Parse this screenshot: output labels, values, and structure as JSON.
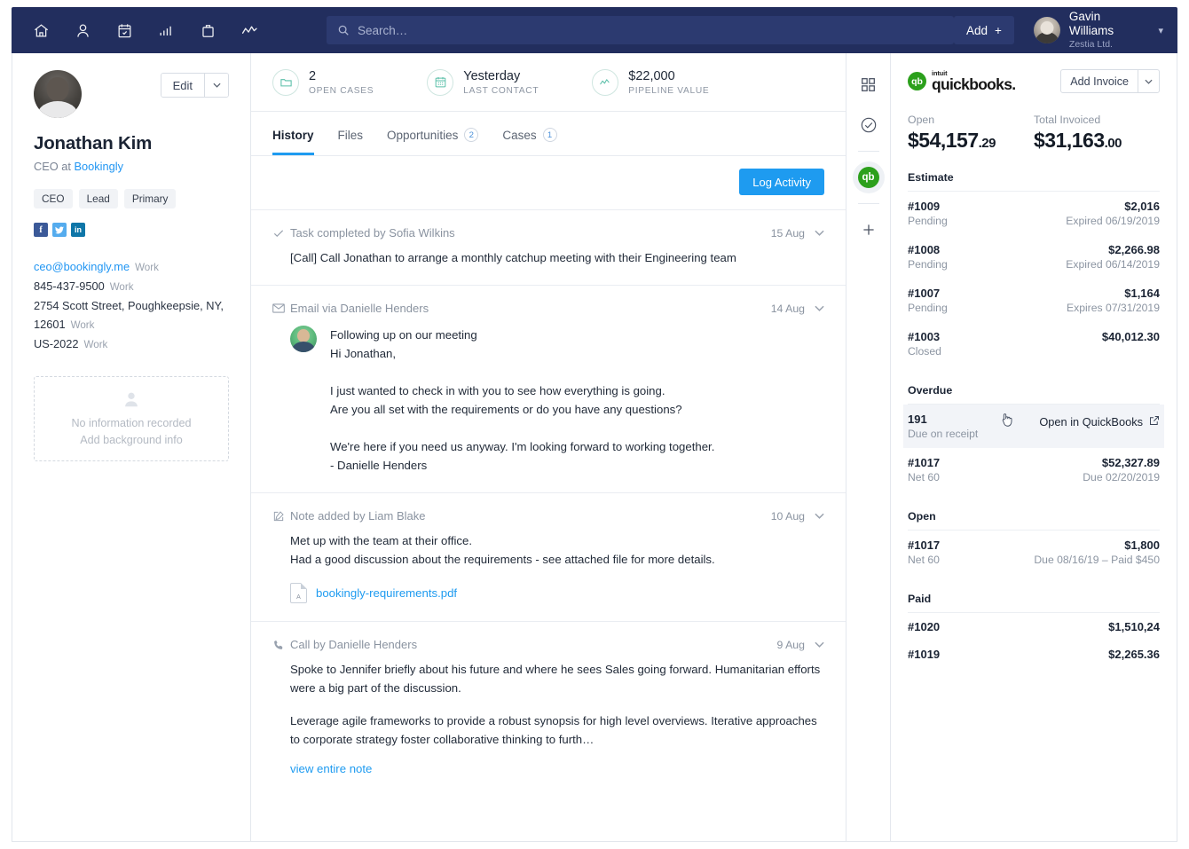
{
  "topnav": {
    "icons": [
      "home-icon",
      "person-icon",
      "calendar-icon",
      "bar-chart-icon",
      "briefcase-icon",
      "trend-line-icon"
    ],
    "search": {
      "placeholder": "Search…",
      "value": ""
    },
    "add_label": "Add",
    "add_plus": "+",
    "user": {
      "name": "Gavin Williams",
      "company": "Zestia Ltd."
    },
    "caret": "▾",
    "bg_color": "#222e5e",
    "search_bg": "#2c3a70"
  },
  "profile": {
    "edit_label": "Edit",
    "edit_caret": "⌄",
    "name": "Jonathan Kim",
    "role_prefix": "CEO at ",
    "company": "Bookingly",
    "tags": [
      "CEO",
      "Lead",
      "Primary"
    ],
    "socials": [
      {
        "name": "facebook",
        "glyph": "f",
        "color": "#3b5998"
      },
      {
        "name": "twitter",
        "glyph": "ᵛ",
        "color": "#55acee"
      },
      {
        "name": "linkedin",
        "glyph": "in",
        "color": "#0e76a8"
      }
    ],
    "contacts": [
      {
        "value": "ceo@bookingly.me",
        "label": "Work",
        "link": true
      },
      {
        "value": "845-437-9500",
        "label": "Work",
        "link": false
      },
      {
        "value": "2754 Scott Street, Poughkeepsie, NY, 12601",
        "label": "Work",
        "link": false
      },
      {
        "value": "US-2022",
        "label": "Work",
        "link": false
      }
    ],
    "background_box": {
      "line1": "No information recorded",
      "line2": "Add background info"
    }
  },
  "stats": [
    {
      "icon": "folder-icon",
      "value": "2",
      "label": "OPEN CASES"
    },
    {
      "icon": "calendar-icon",
      "value": "Yesterday",
      "label": "LAST CONTACT"
    },
    {
      "icon": "trend-line-icon",
      "value": "$22,000",
      "label": "PIPELINE VALUE"
    }
  ],
  "tabs": [
    {
      "label": "History",
      "count": "",
      "active": true
    },
    {
      "label": "Files",
      "count": "",
      "active": false
    },
    {
      "label": "Opportunities",
      "count": "2",
      "active": false
    },
    {
      "label": "Cases",
      "count": "1",
      "active": false
    }
  ],
  "log_activity_label": "Log Activity",
  "feed": [
    {
      "icon": "check-icon",
      "title": "Task completed by Sofia Wilkins",
      "date": "15 Aug",
      "body": "[Call] Call Jonathan to arrange a monthly catchup meeting with their Engineering team"
    },
    {
      "icon": "envelope-icon",
      "title": "Email via Danielle Henders",
      "date": "14 Aug",
      "subject": "Following up on our meeting",
      "greeting": "Hi Jonathan,",
      "para1_line1": "I just wanted to check in with you to see how everything is going.",
      "para1_line2": "Are you all set with the requirements or do you have any questions?",
      "para2_line1": "We're here if you need us anyway. I'm looking forward to working together.",
      "signature": "- Danielle Henders"
    },
    {
      "icon": "note-icon",
      "title": "Note added by Liam Blake",
      "date": "10 Aug",
      "body_line1": "Met up with the team at their office.",
      "body_line2": "Had a good discussion about the requirements - see attached file for more details.",
      "attachment": "bookingly-requirements.pdf"
    },
    {
      "icon": "phone-icon",
      "title": "Call by Danielle Henders",
      "date": "9 Aug",
      "para1": "Spoke to Jennifer briefly about his future and where he sees Sales going forward. Humanitarian efforts were a big part of the discussion.",
      "para2": "Leverage agile frameworks to provide a robust synopsis for high level overviews. Iterative approaches to corporate strategy foster collaborative thinking to furth…",
      "link": "view entire note"
    }
  ],
  "rail": [
    {
      "name": "grid-icon",
      "active": false
    },
    {
      "name": "check-circle-icon",
      "active": false
    },
    {
      "name": "quickbooks-icon",
      "active": true,
      "glyph": "qb"
    },
    {
      "name": "plus-icon",
      "active": false,
      "glyph": "+"
    }
  ],
  "quickbooks": {
    "logo_intuit": "intuit",
    "logo_word": "quickbooks.",
    "logo_mark": "qb",
    "brand_color": "#2ca01c",
    "add_invoice_label": "Add Invoice",
    "add_invoice_caret": "⌄",
    "totals": [
      {
        "caption": "Open",
        "dollars": "$54,157",
        "cents": ".29"
      },
      {
        "caption": "Total Invoiced",
        "dollars": "$31,163",
        "cents": ".00"
      }
    ],
    "sections": [
      {
        "title": "Estimate",
        "rows": [
          {
            "id": "#1009",
            "status": "Pending",
            "amount": "$2,016",
            "due": "Expired 06/19/2019",
            "hover": false
          },
          {
            "id": "#1008",
            "status": "Pending",
            "amount": "$2,266.98",
            "due": "Expired 06/14/2019",
            "hover": false
          },
          {
            "id": "#1007",
            "status": "Pending",
            "amount": "$1,164",
            "due": "Expires 07/31/2019",
            "hover": false
          },
          {
            "id": "#1003",
            "status": "Closed",
            "amount": "$40,012.30",
            "due": "",
            "hover": false
          }
        ]
      },
      {
        "title": "Overdue",
        "rows": [
          {
            "id": "191",
            "status": "Due on receipt",
            "amount": "",
            "due": "",
            "hover": true,
            "open_label": "Open in QuickBooks"
          },
          {
            "id": "#1017",
            "status": "Net 60",
            "amount": "$52,327.89",
            "due": "Due 02/20/2019",
            "hover": false
          }
        ]
      },
      {
        "title": "Open",
        "rows": [
          {
            "id": "#1017",
            "status": "Net 60",
            "amount": "$1,800",
            "due": "Due 08/16/19 – Paid $450",
            "hover": false
          }
        ]
      },
      {
        "title": "Paid",
        "rows": [
          {
            "id": "#1020",
            "status": "",
            "amount": "$1,510,24",
            "due": "",
            "hover": false
          },
          {
            "id": "#1019",
            "status": "",
            "amount": "$2,265.36",
            "due": "",
            "hover": false
          }
        ]
      }
    ]
  }
}
